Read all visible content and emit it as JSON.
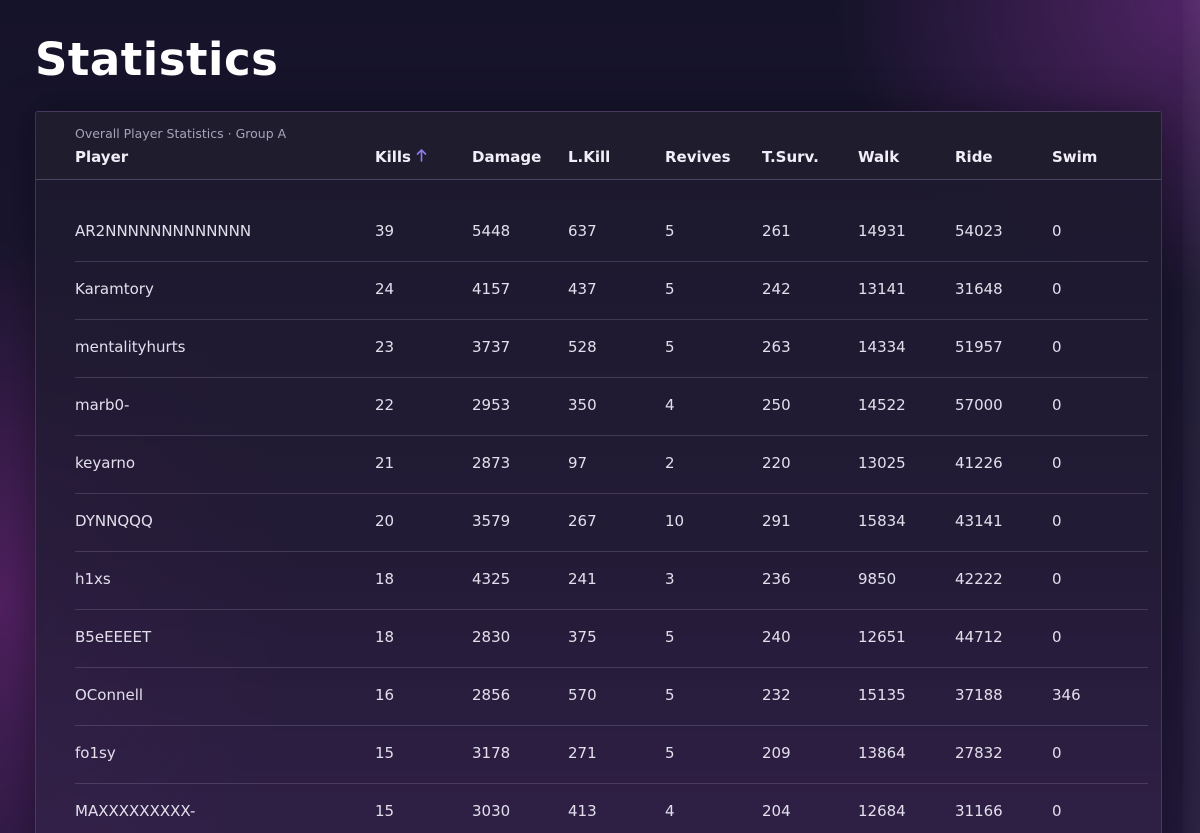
{
  "page": {
    "title": "Statistics"
  },
  "table": {
    "caption": "Overall Player Statistics · Group A",
    "columns": {
      "player": "Player",
      "kills": "Kills",
      "damage": "Damage",
      "lkill": "L.Kill",
      "revives": "Revives",
      "tsurv": "T.Surv.",
      "walk": "Walk",
      "ride": "Ride",
      "swim": "Swim"
    },
    "sort": {
      "column": "kills",
      "icon": "arrow-up-icon",
      "color": "#8d7cf0"
    },
    "rows": [
      {
        "player": "AR2NNNNNNNNNNNNN",
        "kills": "39",
        "damage": "5448",
        "lkill": "637",
        "revives": "5",
        "tsurv": "261",
        "walk": "14931",
        "ride": "54023",
        "swim": "0"
      },
      {
        "player": "Karamtory",
        "kills": "24",
        "damage": "4157",
        "lkill": "437",
        "revives": "5",
        "tsurv": "242",
        "walk": "13141",
        "ride": "31648",
        "swim": "0"
      },
      {
        "player": "mentalityhurts",
        "kills": "23",
        "damage": "3737",
        "lkill": "528",
        "revives": "5",
        "tsurv": "263",
        "walk": "14334",
        "ride": "51957",
        "swim": "0"
      },
      {
        "player": "marb0-",
        "kills": "22",
        "damage": "2953",
        "lkill": "350",
        "revives": "4",
        "tsurv": "250",
        "walk": "14522",
        "ride": "57000",
        "swim": "0"
      },
      {
        "player": "keyarno",
        "kills": "21",
        "damage": "2873",
        "lkill": "97",
        "revives": "2",
        "tsurv": "220",
        "walk": "13025",
        "ride": "41226",
        "swim": "0"
      },
      {
        "player": "DYNNQQQ",
        "kills": "20",
        "damage": "3579",
        "lkill": "267",
        "revives": "10",
        "tsurv": "291",
        "walk": "15834",
        "ride": "43141",
        "swim": "0"
      },
      {
        "player": "h1xs",
        "kills": "18",
        "damage": "4325",
        "lkill": "241",
        "revives": "3",
        "tsurv": "236",
        "walk": "9850",
        "ride": "42222",
        "swim": "0"
      },
      {
        "player": "B5eEEEET",
        "kills": "18",
        "damage": "2830",
        "lkill": "375",
        "revives": "5",
        "tsurv": "240",
        "walk": "12651",
        "ride": "44712",
        "swim": "0"
      },
      {
        "player": "OConnell",
        "kills": "16",
        "damage": "2856",
        "lkill": "570",
        "revives": "5",
        "tsurv": "232",
        "walk": "15135",
        "ride": "37188",
        "swim": "346"
      },
      {
        "player": "fo1sy",
        "kills": "15",
        "damage": "3178",
        "lkill": "271",
        "revives": "5",
        "tsurv": "209",
        "walk": "13864",
        "ride": "27832",
        "swim": "0"
      },
      {
        "player": "MAXXXXXXXXX-",
        "kills": "15",
        "damage": "3030",
        "lkill": "413",
        "revives": "4",
        "tsurv": "204",
        "walk": "12684",
        "ride": "31166",
        "swim": "0"
      }
    ]
  }
}
